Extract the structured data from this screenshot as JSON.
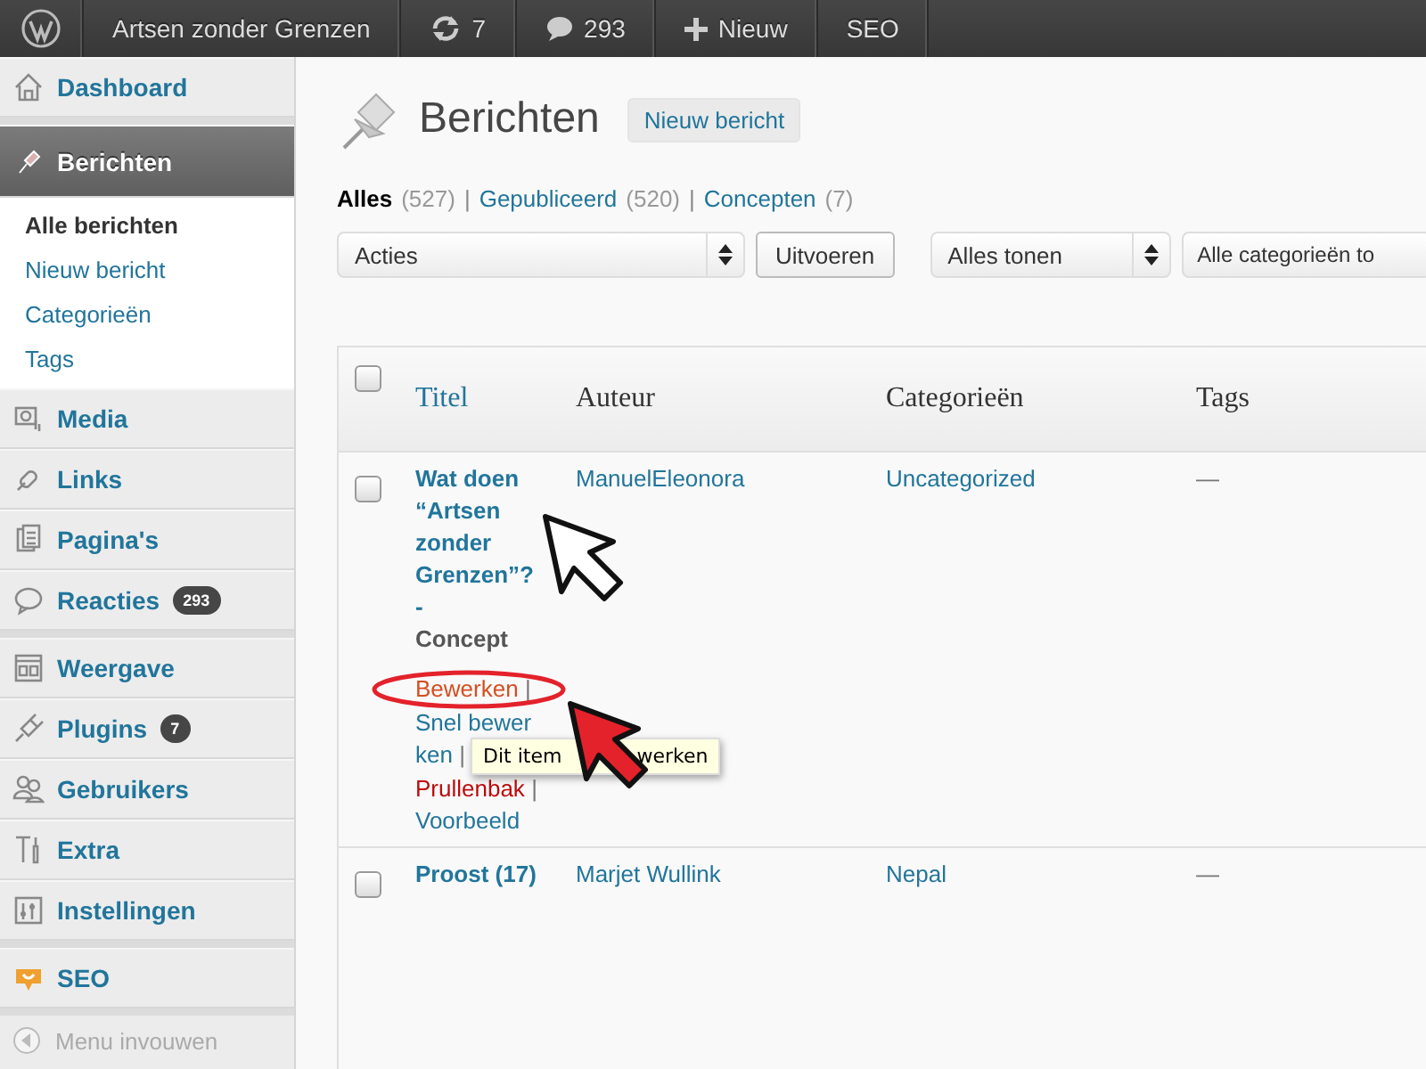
{
  "admin_bar": {
    "site_title": "Artsen zonder Grenzen",
    "updates": "7",
    "comments": "293",
    "new_label": "Nieuw",
    "seo": "SEO"
  },
  "sidebar": {
    "groups": [
      [
        {
          "label": "Dashboard",
          "selected": false
        }
      ],
      [
        {
          "label": "Berichten",
          "selected": true,
          "children": [
            {
              "label": "Alle berichten",
              "selected": true
            },
            {
              "label": "Nieuw bericht",
              "selected": false
            },
            {
              "label": "Categorieën",
              "selected": false
            },
            {
              "label": "Tags",
              "selected": false
            }
          ]
        },
        {
          "label": "Media",
          "selected": false
        },
        {
          "label": "Links",
          "selected": false
        },
        {
          "label": "Pagina's",
          "selected": false
        },
        {
          "label": "Reacties",
          "selected": false,
          "badge": "293"
        }
      ],
      [
        {
          "label": "Weergave",
          "selected": false
        },
        {
          "label": "Plugins",
          "selected": false,
          "badge": "7"
        },
        {
          "label": "Gebruikers",
          "selected": false
        },
        {
          "label": "Extra",
          "selected": false
        },
        {
          "label": "Instellingen",
          "selected": false
        }
      ],
      [
        {
          "label": "SEO",
          "selected": false
        }
      ]
    ],
    "collapse": "Menu invouwen"
  },
  "heading": "Berichten",
  "add_button": "Nieuw bericht",
  "filters": [
    {
      "label": "Alles",
      "count": "(527)",
      "selected": true
    },
    {
      "label": "Gepubliceerd",
      "count": "(520)",
      "selected": false
    },
    {
      "label": "Concepten",
      "count": "(7)",
      "selected": false
    }
  ],
  "filter_separator": "|",
  "bulk_actions": {
    "value": "Acties"
  },
  "apply_button": "Uitvoeren",
  "selects": [
    "Alles tonen",
    "Alle categorieën to"
  ],
  "table": {
    "select_all_checked": false,
    "columns": [
      {
        "label": "Titel",
        "sortable": true
      },
      {
        "label": "Auteur",
        "sortable": false
      },
      {
        "label": "Categorieën",
        "sortable": false
      },
      {
        "label": "Tags",
        "sortable": false
      }
    ],
    "rows": [
      {
        "checked": false,
        "title": "Wat doen “Artsen zonder Grenzen”? -",
        "state": "Concept",
        "author": "ManuelEleonora",
        "category": "Uncategorized",
        "tags": "—",
        "actions": [
          {
            "label": "Bewerken",
            "separator": "|",
            "kind": "edit",
            "hover": true
          },
          {
            "label": "Snel bewerken",
            "separator": "|",
            "kind": "edit",
            "hover": false
          },
          {
            "label": "Prullenbak",
            "separator": "|",
            "kind": "trash",
            "hover": false
          },
          {
            "label": "Voorbeeld",
            "kind": "edit",
            "hover": false
          }
        ]
      },
      {
        "checked": false,
        "title": "Proost (17)",
        "author": "Marjet Wullink",
        "category": "Nepal",
        "tags": "—"
      }
    ]
  },
  "tooltip": {
    "parts": [
      "Dit item",
      "werken"
    ]
  },
  "overlays": [
    {
      "kind": "pointer",
      "color": "#ffffff"
    },
    {
      "kind": "pointer",
      "color": "#e3222b"
    },
    {
      "kind": "ring"
    }
  ]
}
